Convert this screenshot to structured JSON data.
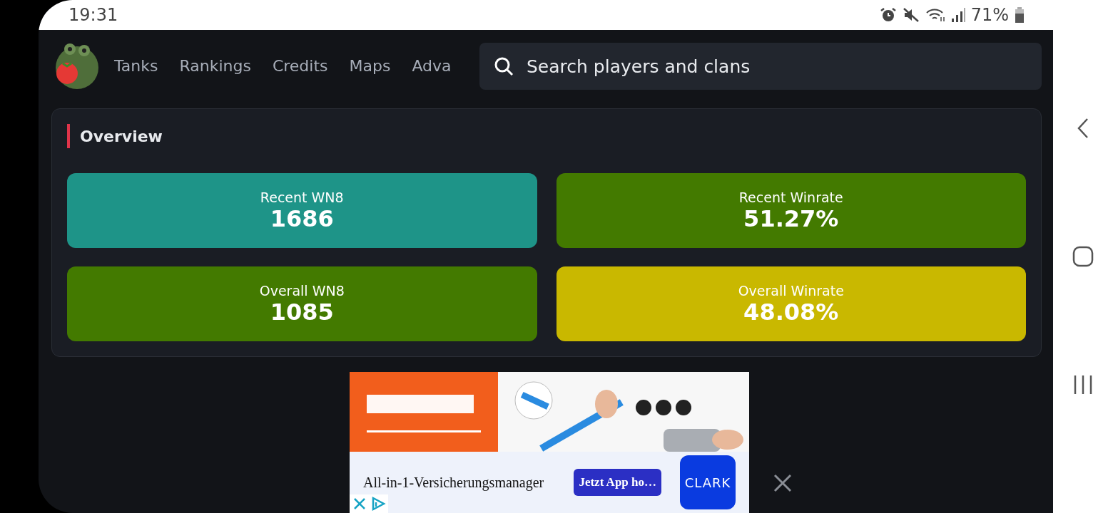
{
  "status_bar": {
    "time": "19:31",
    "battery": "71%"
  },
  "nav": {
    "links": [
      {
        "label": "Tanks"
      },
      {
        "label": "Rankings"
      },
      {
        "label": "Credits"
      },
      {
        "label": "Maps"
      },
      {
        "label": "Adva"
      }
    ],
    "search": {
      "placeholder": "Search players and clans"
    }
  },
  "overview": {
    "title": "Overview",
    "tiles": [
      {
        "label": "Recent WN8",
        "value": "1686",
        "color": "#1e9488"
      },
      {
        "label": "Recent Winrate",
        "value": "51.27%",
        "color": "#437a00"
      },
      {
        "label": "Overall WN8",
        "value": "1085",
        "color": "#437a00"
      },
      {
        "label": "Overall Winrate",
        "value": "48.08%",
        "color": "#c9b800"
      }
    ]
  },
  "ad": {
    "kind": "picture",
    "headline": "All-in-1-Versicherungsmanager",
    "cta": "Jetzt App ho…",
    "logo": "CLARK"
  }
}
